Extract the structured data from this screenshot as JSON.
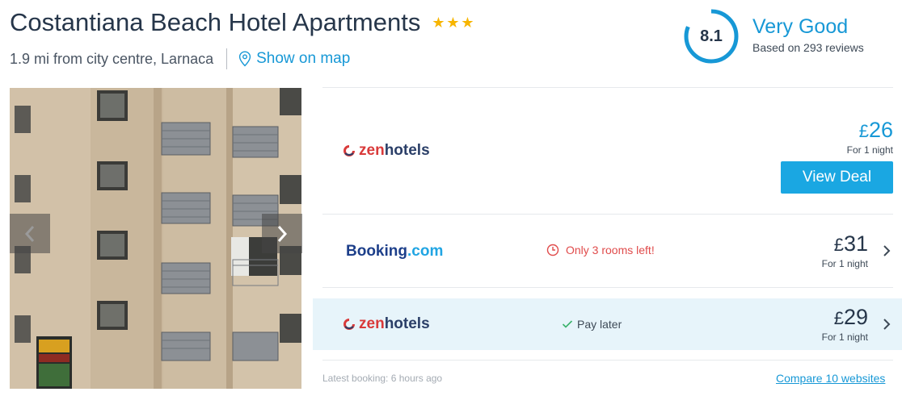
{
  "hotel": {
    "name": "Costantiana Beach Hotel Apartments",
    "stars": 3,
    "distance": "1.9 mi from city centre, Larnaca",
    "map_link": "Show on map"
  },
  "rating": {
    "score": "8.1",
    "label": "Very Good",
    "reviews": "Based on 293 reviews"
  },
  "gallery": {
    "prev_icon": "chevron-left-icon",
    "next_icon": "chevron-right-icon"
  },
  "deals": [
    {
      "provider": "zenhotels",
      "provider_parts": [
        "zen",
        "hotels"
      ],
      "currency": "£",
      "price": "26",
      "per_night": "For 1 night",
      "cta": "View Deal",
      "highlight": false
    },
    {
      "provider": "Booking.com",
      "provider_parts": [
        "Booking",
        ".com"
      ],
      "notice": "Only 3 rooms left!",
      "notice_icon": "clock-icon",
      "currency": "£",
      "price": "31",
      "per_night": "For 1 night",
      "highlight": false
    },
    {
      "provider": "zenhotels",
      "provider_parts": [
        "zen",
        "hotels"
      ],
      "notice": "Pay later",
      "notice_icon": "check-icon",
      "currency": "£",
      "price": "29",
      "per_night": "For 1 night",
      "highlight": true
    }
  ],
  "footer": {
    "latest_booking": "Latest booking: 6 hours ago",
    "compare_link": "Compare 10 websites"
  },
  "colors": {
    "accent": "#1798d6",
    "cta": "#1aa7e2",
    "star": "#f7b500",
    "warning": "#e04b4b",
    "highlight_row": "#e7f4fa"
  }
}
